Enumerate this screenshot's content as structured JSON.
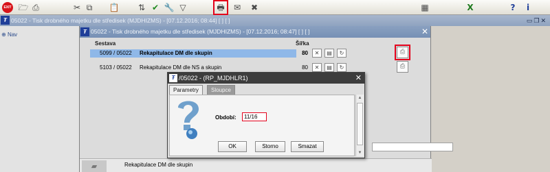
{
  "toolbar": {
    "exit_label": "EXIT",
    "icons": [
      {
        "name": "save-icon",
        "glyph": "🗁"
      },
      {
        "name": "print-icon",
        "glyph": "⎙"
      },
      {
        "name": "cut-icon",
        "glyph": "✂"
      },
      {
        "name": "copy-icon",
        "glyph": "⧉"
      },
      {
        "name": "paste-icon",
        "glyph": "📋"
      },
      {
        "name": "sort-icon",
        "glyph": "⇅"
      },
      {
        "name": "check-icon",
        "glyph": "✔"
      },
      {
        "name": "tools-icon",
        "glyph": "🔧"
      },
      {
        "name": "filter-icon",
        "glyph": "▽"
      },
      {
        "name": "report-icon",
        "glyph": "🖶"
      },
      {
        "name": "mail-icon",
        "glyph": "✉"
      },
      {
        "name": "close-icon",
        "glyph": "✖"
      },
      {
        "name": "calendar-icon",
        "glyph": "▦"
      },
      {
        "name": "excel-icon",
        "glyph": "X"
      },
      {
        "name": "help-icon",
        "glyph": "?"
      },
      {
        "name": "info-icon",
        "glyph": "i"
      }
    ]
  },
  "outer_window": {
    "title": "05022 - Tisk drobného majetku dle středisek (MJDHIZMS) - [07.12.2016; 08:44]  [ ]  [ ]",
    "logo": "Ŧ",
    "controls": "▭❐✕"
  },
  "nav": {
    "label": "Nav"
  },
  "inner_window": {
    "title": "05022 - Tisk drobného majetku dle středisek (MJDHIZMS) - [07.12.2016; 08:47]  [ ]  [ ]",
    "close": "✕",
    "columns": {
      "sestava": "Sestava",
      "sirka": "Šířka"
    },
    "rows": [
      {
        "code": "5099 / 05022",
        "name": "Rekapitulace DM dle skupin",
        "width": "80"
      },
      {
        "code": "5103 / 05022",
        "name": "Rekapitulace DM dle NS a skupin",
        "width": "80"
      }
    ],
    "bottom_text": "Rekapitulace DM dle skupin"
  },
  "dialog": {
    "title": "/05022 - (RP_MJDHLR1)",
    "close": "✕",
    "tabs": [
      "Parametry",
      "Sloupce"
    ],
    "field_label": "Období:",
    "field_value": "11/16",
    "buttons": {
      "ok": "OK",
      "storno": "Storno",
      "smazat": "Smazat"
    }
  },
  "colors": {
    "highlight": "#e3001b",
    "selected_row": "#8fb8e8",
    "title_bar": "#7690b5"
  }
}
